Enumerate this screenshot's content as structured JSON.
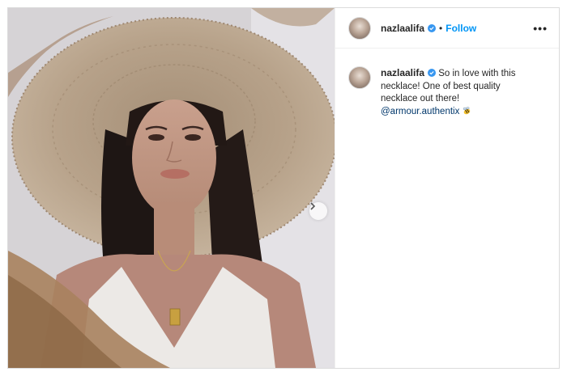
{
  "post": {
    "username": "nazlaalifa",
    "separator": "•",
    "follow_label": "Follow",
    "more_label": "•••",
    "caption_text": "So in love with this necklace! One of best quality necklace out there!",
    "mention": "@armour.authentix",
    "emoji": "bee-emoji",
    "verified_color": "#3897f0",
    "follow_color": "#0095f6"
  }
}
